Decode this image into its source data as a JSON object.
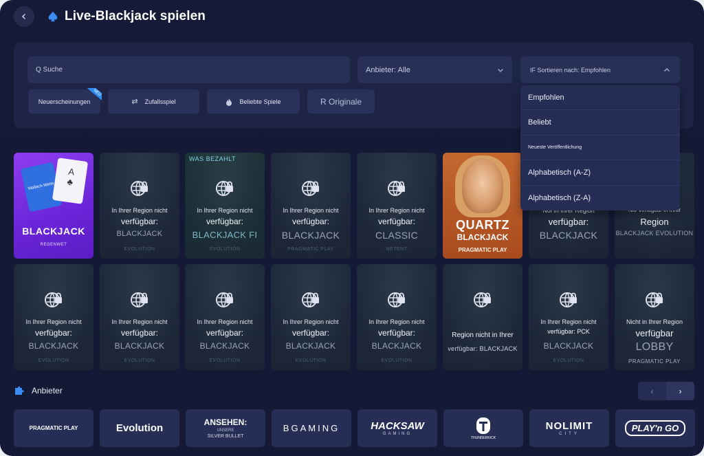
{
  "header": {
    "back_icon": "chevron-left-icon",
    "title_icon": "spade-icon",
    "title": "Live-Blackjack spielen"
  },
  "filters": {
    "search_placeholder": "Q Suche",
    "provider_label": "Anbieter: Alle",
    "sort_label": "IF Sortieren nach: Empfohlen",
    "chips": [
      {
        "label": "Neuerscheinungen",
        "badge": "NEU"
      },
      {
        "label": "Zufallsspiel",
        "icon": "shuffle-icon"
      },
      {
        "label": "Beliebte Spiele",
        "icon": "fire-icon"
      },
      {
        "label": "R Originale"
      }
    ],
    "sort_options": [
      "Empfohlen",
      "Beliebt",
      "Neueste Veröffentlichung",
      "Alphabetisch (A-Z)",
      "Alphabetisch (Z-A)"
    ]
  },
  "games_row1": [
    {
      "kind": "promo",
      "title": "BLACKJACK",
      "sub": "REGENWET",
      "card_text": "Wallach-Wette",
      "card_a": "A"
    },
    {
      "t1": "In Ihrer Region nicht",
      "t2": "verfügbar:",
      "t3": "BLACKJACK",
      "t4": "EVOLUTION"
    },
    {
      "tag": "WAS BEZAHLT",
      "t1": "In Ihrer Region nicht",
      "t2": "verfügbar:",
      "t3": "BLACKJACK FI",
      "t4": "EVOLUTION"
    },
    {
      "t1": "In Ihrer Region nicht",
      "t2": "verfügbar:",
      "t3": "BLACKJACK",
      "t4": "PRAGMATIC PLAY"
    },
    {
      "t1": "In Ihrer Region nicht",
      "t2": "verfügbar:",
      "t3": "CLASSIC",
      "t4": "NETENT"
    },
    {
      "kind": "quartz",
      "line1": "QUARTZ",
      "line2": "BLACKJACK",
      "provider": "PRAGMATIC PLAY"
    },
    {
      "t1": "Noi In Ihrer Region",
      "t2": "verfügbar:",
      "t3": "BLACKJACK",
      "t4": ""
    },
    {
      "t1": "Nio Verfügbar in Ihrer",
      "t2": "Region",
      "t3": "BLACKJACK EVOLUTION",
      "t4": ""
    }
  ],
  "games_row2": [
    {
      "t1": "In Ihrer Region nicht",
      "t2": "verfügbar:",
      "t3": "BLACKJACK",
      "t4": "EVOLUTION"
    },
    {
      "t1": "In Ihrer Region nicht",
      "t2": "verfügbar:",
      "t3": "BLACKJACK",
      "t4": "EVOLUTION"
    },
    {
      "t1": "In Ihrer Region nicht",
      "t2": "verfügbar:",
      "t3": "BLACKJACK",
      "t4": "EVOLUTION"
    },
    {
      "t1": "In Ihrer Region nicht",
      "t2": "verfügbar:",
      "t3": "BLACKJACK",
      "t4": "EVOLUTION"
    },
    {
      "t1": "In Ihrer Region nicht",
      "t2": "verfügbar:",
      "t3": "BLACKJACK",
      "t4": "EVOLUTION"
    },
    {
      "t1": "",
      "t2": "Region nicht in Ihrer",
      "t3": "verfügbar: BLACKJACK",
      "t4": ""
    },
    {
      "t1": "In Ihrer Region nicht",
      "t2": "verfügbar: PCK",
      "t3": "BLACKJACK",
      "t4": "EVOLUTION"
    },
    {
      "t1": "Nicht in Ihrer Region",
      "t2": "verfügbar",
      "t3": "LOBBY",
      "t4": "PRAGMATIC PLAY"
    }
  ],
  "providers": {
    "title": "Anbieter",
    "prev": "‹",
    "next": "›",
    "items": [
      "PRAGMATIC PLAY",
      "Evolution",
      "ANSEHEN:",
      "BGAMING",
      "HACKSAW",
      "THUNDERKICK",
      "NOLIMIT",
      "PLAY'n GO"
    ],
    "item_subs": {
      "ansehen_small": "UNSERE",
      "ansehen_sub": "SILVER BULLET",
      "hacksaw_sub": "GAMING",
      "nolimit_sub": "CITY"
    }
  }
}
